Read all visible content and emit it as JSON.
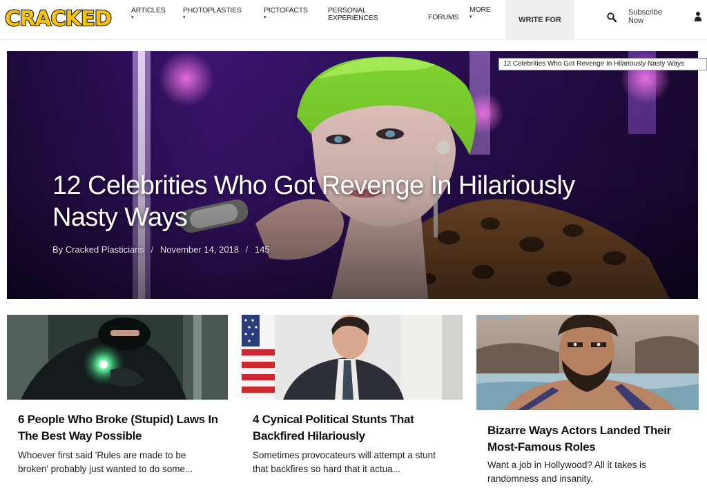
{
  "header": {
    "logo_text": "CRACKED",
    "nav": [
      {
        "label": "ARTICLES",
        "has_caret": true
      },
      {
        "label": "PHOTOPLASTIES",
        "has_caret": true
      },
      {
        "label": "PICTOFACTS",
        "has_caret": true
      },
      {
        "label": "PERSONAL EXPERIENCES",
        "has_caret": false
      },
      {
        "label": "FORUMS",
        "has_caret": false
      },
      {
        "label": "MORE",
        "has_caret": true
      }
    ],
    "write_for": "WRITE FOR",
    "subscribe": "Subscribe Now",
    "search_icon": "search-icon",
    "user_icon": "user-icon",
    "caret_glyph": "▾"
  },
  "hero": {
    "title": "12 Celebrities Who Got Revenge In Hilariously Nasty Ways",
    "author": "By Cracked Plasticians",
    "separator": "/",
    "date": "November 14, 2018",
    "comments": "145",
    "tooltip": "12 Celebrities Who Got Revenge In Hilariously Nasty Ways",
    "accent_color": "#7a2cc0"
  },
  "cards": [
    {
      "title": "6 People Who Broke (Stupid) Laws In The Best Way Possible",
      "description": "Whoever first said 'Rules are made to be broken' probably just wanted to do some...",
      "tag": ""
    },
    {
      "title": "4 Cynical Political Stunts That Backfired Hilariously",
      "description": "Sometimes provocateurs will attempt a stunt that backfires so hard that it actua...",
      "tag": ""
    },
    {
      "title": "Bizarre Ways Actors Landed Their Most-Famous Roles",
      "description": "Want a job in Hollywood? All it takes is randomness and insanity.",
      "tag": "PICTOFACTS"
    }
  ],
  "colors": {
    "logo_yellow": "#f5c20b",
    "logo_outline": "#1a1a1a",
    "tag_blue": "#6fb7e6"
  }
}
